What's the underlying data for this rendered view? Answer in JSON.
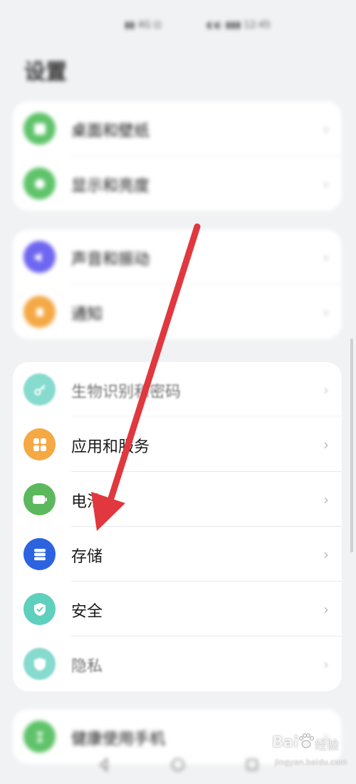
{
  "status_bar": {
    "left_text": "▮▮ 4G ⊡",
    "right_text": "◐◐ ▮▮▮ 12:45"
  },
  "page_title": "设置",
  "cards": [
    {
      "items": [
        {
          "label": "桌面和壁纸",
          "color": "#5fc36a"
        },
        {
          "label": "显示和亮度",
          "color": "#5fc36a"
        }
      ]
    },
    {
      "items": [
        {
          "label": "声音和振动",
          "color": "#6e66f0"
        },
        {
          "label": "通知",
          "color": "#f4a945"
        }
      ]
    },
    {
      "items": [
        {
          "label": "生物识别和密码",
          "color": "#5fcfbe"
        },
        {
          "label": "应用和服务",
          "color": "#f4a945"
        },
        {
          "label": "电池",
          "color": "#5cb85c"
        },
        {
          "label": "存储",
          "color": "#2b63e0"
        },
        {
          "label": "安全",
          "color": "#5fcfbe"
        },
        {
          "label": "隐私",
          "color": "#5fcfbe"
        }
      ]
    },
    {
      "items": [
        {
          "label": "健康使用手机",
          "color": "#5fc36a"
        }
      ]
    }
  ],
  "chevron": "›",
  "watermark": {
    "brand": "Bai",
    "product": "经验",
    "domain": "jingyan.baidu.com"
  },
  "annotation": {
    "arrow_color": "#e0383e"
  }
}
